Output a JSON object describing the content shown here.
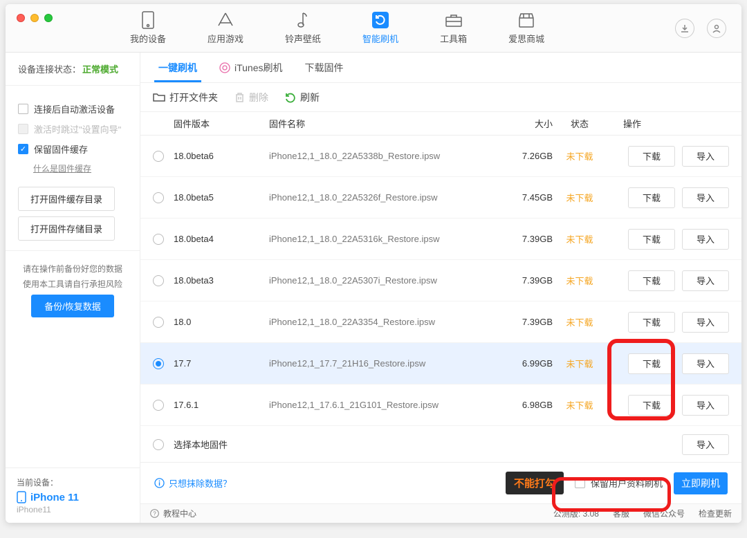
{
  "nav": [
    {
      "label": "我的设备"
    },
    {
      "label": "应用游戏"
    },
    {
      "label": "铃声壁纸"
    },
    {
      "label": "智能刷机"
    },
    {
      "label": "工具箱"
    },
    {
      "label": "爱思商城"
    }
  ],
  "nav_active_index": 3,
  "sidebar": {
    "conn_label": "设备连接状态：",
    "conn_mode": "正常模式",
    "chk_autoactivate": "连接后自动激活设备",
    "chk_skipwizard": "激活时跳过\"设置向导\"",
    "chk_keepcache": "保留固件缓存",
    "whatis_link": "什么是固件缓存",
    "btn_open_cache": "打开固件缓存目录",
    "btn_open_store": "打开固件存储目录",
    "note_line1": "请在操作前备份好您的数据",
    "note_line2": "使用本工具请自行承担风险",
    "backup_btn": "备份/恢复数据",
    "curdev_label": "当前设备：",
    "curdev_name": "iPhone 11",
    "curdev_sub": "iPhone11"
  },
  "subtabs": [
    {
      "label": "一键刷机"
    },
    {
      "label": "iTunes刷机"
    },
    {
      "label": "下载固件"
    }
  ],
  "subtab_active_index": 0,
  "toolbar": {
    "open_folder": "打开文件夹",
    "delete": "删除",
    "refresh": "刷新"
  },
  "table": {
    "col_version": "固件版本",
    "col_name": "固件名称",
    "col_size": "大小",
    "col_status": "状态",
    "col_ops": "操作",
    "download_label": "下载",
    "import_label": "导入",
    "rows": [
      {
        "version": "18.0beta6",
        "name": "iPhone12,1_18.0_22A5338b_Restore.ipsw",
        "size": "7.26GB",
        "status": "未下载"
      },
      {
        "version": "18.0beta5",
        "name": "iPhone12,1_18.0_22A5326f_Restore.ipsw",
        "size": "7.45GB",
        "status": "未下载"
      },
      {
        "version": "18.0beta4",
        "name": "iPhone12,1_18.0_22A5316k_Restore.ipsw",
        "size": "7.39GB",
        "status": "未下载"
      },
      {
        "version": "18.0beta3",
        "name": "iPhone12,1_18.0_22A5307i_Restore.ipsw",
        "size": "7.39GB",
        "status": "未下载"
      },
      {
        "version": "18.0",
        "name": "iPhone12,1_18.0_22A3354_Restore.ipsw",
        "size": "7.39GB",
        "status": "未下载"
      },
      {
        "version": "17.7",
        "name": "iPhone12,1_17.7_21H16_Restore.ipsw",
        "size": "6.99GB",
        "status": "未下载"
      },
      {
        "version": "17.6.1",
        "name": "iPhone12,1_17.6.1_21G101_Restore.ipsw",
        "size": "6.98GB",
        "status": "未下载"
      }
    ],
    "selected_index": 5,
    "local_label": "选择本地固件"
  },
  "bottom": {
    "erase_link": "只想抹除数据？",
    "overlay_warning": "不能打勾",
    "keep_data": "保留用户资料刷机",
    "flash_btn": "立即刷机"
  },
  "statusbar": {
    "tutorial": "教程中心",
    "version": "公测版: 3.08",
    "kefu": "客服",
    "wechat": "微信公众号",
    "update": "检查更新"
  }
}
